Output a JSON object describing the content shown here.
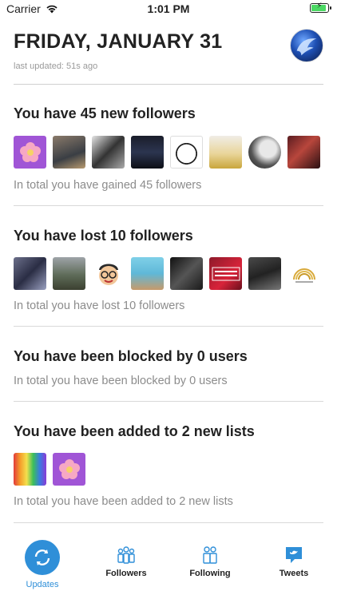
{
  "status": {
    "carrier": "Carrier",
    "time": "1:01 PM"
  },
  "header": {
    "date": "FRIDAY, JANUARY 31",
    "last_updated": "last updated: 51s ago"
  },
  "sections": {
    "new_followers": {
      "title": "You have 45 new followers",
      "total": "In total you have gained 45 followers"
    },
    "lost_followers": {
      "title": "You have lost 10 followers",
      "total": "In total you have lost 10 followers"
    },
    "blocked": {
      "title": "You have been blocked by 0 users",
      "total": "In total you have been blocked by 0 users"
    },
    "lists": {
      "title": "You have been added to 2 new lists",
      "total": "In total you have been added to 2 new lists"
    }
  },
  "tabs": {
    "updates": "Updates",
    "followers": "Followers",
    "following": "Following",
    "tweets": "Tweets"
  },
  "colors": {
    "accent": "#2f8fd8",
    "battery": "#4cd964"
  }
}
